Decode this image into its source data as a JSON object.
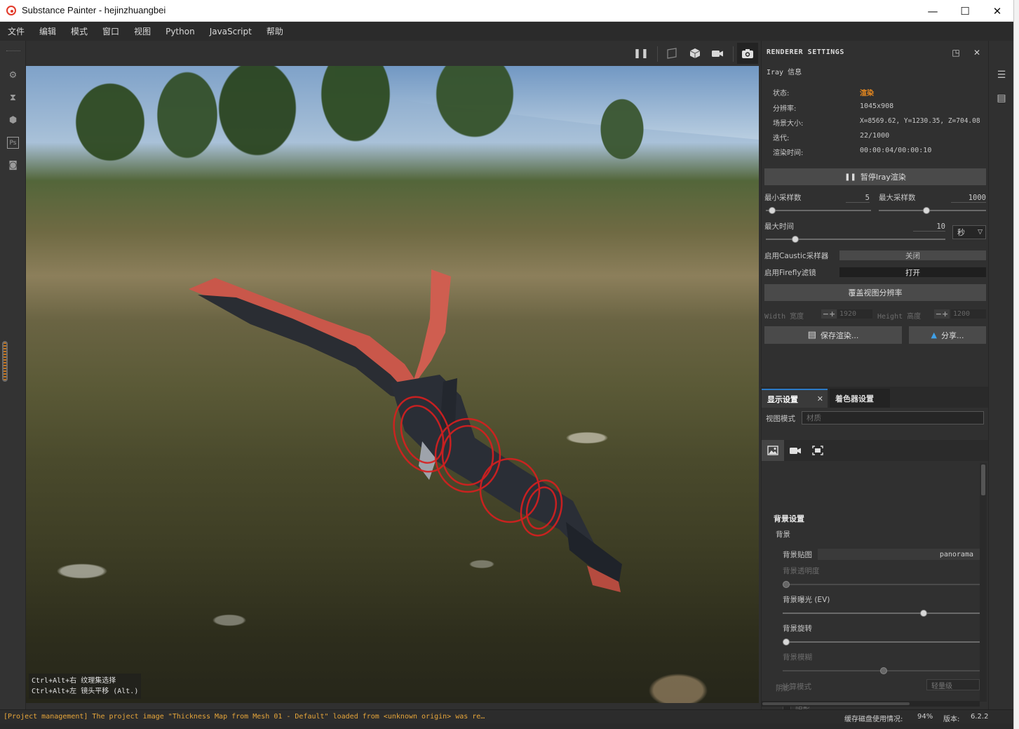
{
  "window": {
    "title": "Substance Painter - hejinzhuangbei",
    "minimize": "—",
    "maximize": "☐",
    "close": "✕"
  },
  "menu": [
    "文件",
    "编辑",
    "模式",
    "窗口",
    "视图",
    "Python",
    "JavaScript",
    "帮助"
  ],
  "viewport": {
    "hints": [
      "Ctrl+Alt+右 纹理集选择",
      "Ctrl+Alt+左 镜头平移 (Alt.)"
    ]
  },
  "renderer": {
    "title": "RENDERER SETTINGS",
    "subtitle": "Iray 信息",
    "info": [
      {
        "key": "状态:",
        "value": "渲染"
      },
      {
        "key": "分辨率:",
        "value": "1045x908"
      },
      {
        "key": "场景大小:",
        "value": "X=8569.62,  Y=1230.35,  Z=704.08"
      },
      {
        "key": "迭代:",
        "value": "22/1000"
      },
      {
        "key": "渲染时间:",
        "value": "00:00:04/00:00:10"
      }
    ],
    "status_color": "#e8891f",
    "pause_label": "暂停Iray渲染",
    "min_samples_label": "最小采样数",
    "min_samples_value": "5",
    "min_samples_fraction": 0.03,
    "max_samples_label": "最大采样数",
    "max_samples_value": "1000",
    "max_samples_fraction": 0.44,
    "max_time_label": "最大时间",
    "max_time_value": "10",
    "max_time_fraction": 0.15,
    "time_unit": "秒",
    "caustic_label": "启用Caustic采样器",
    "caustic_value": "关闭",
    "firefly_label": "启用Firefly滤镜",
    "firefly_value": "打开",
    "override_label": "覆盖视图分辨率",
    "width_label": "Width 宽度",
    "width_value": "1920",
    "height_label": "Height 高度",
    "height_value": "1200",
    "save_label": "保存渲染...",
    "share_label": "分享..."
  },
  "display": {
    "tab_display": "显示设置",
    "tab_shader": "着色器设置",
    "view_mode_label": "视图模式",
    "view_mode_placeholder": "材质",
    "section_title": "背景设置",
    "background_label": "背景",
    "bg_map_label": "背景贴图",
    "bg_map_value": "panorama",
    "bg_opacity_label": "背景透明度",
    "bg_opacity_fraction": 0.0,
    "bg_exposure_label": "背景曝光 (EV)",
    "bg_exposure_fraction": 0.72,
    "bg_rotation_label": "背景旋转",
    "bg_rotation_fraction": 0.0,
    "bg_blur_label": "背景模糊",
    "bg_blur_fraction": 0.51,
    "shadow_section": "阴影",
    "shadow_label": "阴影",
    "compute_mode_label": "计算模式",
    "compute_mode_value": "轻量级"
  },
  "statusbar": {
    "log": "[Project management] The project image \"Thickness Map from Mesh 01 - Default\" loaded from <unknown origin> was re…",
    "cache_label": "缓存磁盘使用情况:",
    "cache_value": "94%",
    "version_label": "版本:",
    "version_value": "6.2.2"
  },
  "icons": {
    "left_toolbar": [
      "settings-icon",
      "history-icon",
      "layer-icon",
      "photoshop-icon",
      "camera-capture-icon"
    ],
    "viewport_toolbar": [
      "pause-icon",
      "2d-view-icon",
      "3d-view-icon",
      "camera-icon",
      "screenshot-icon"
    ],
    "right_dock": [
      "layers-panel-icon",
      "properties-panel-icon"
    ]
  }
}
